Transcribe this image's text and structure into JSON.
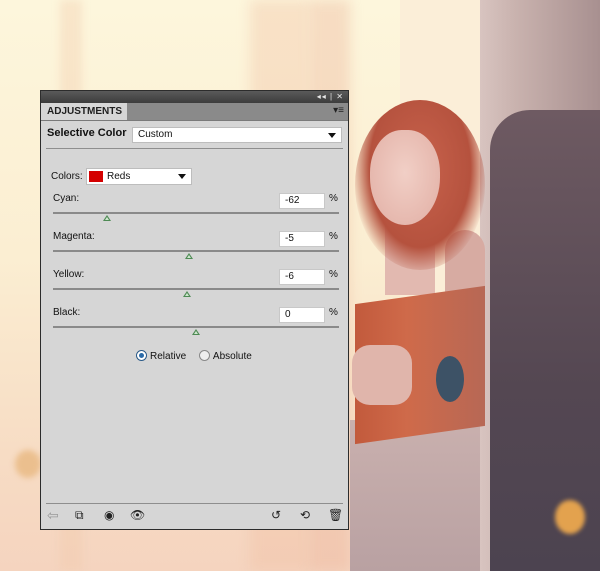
{
  "panel": {
    "title_controls": "◂◂ | ✕",
    "tab_label": "ADJUSTMENTS",
    "menu_icon": "panel-menu-icon",
    "adjustment_name": "Selective Color",
    "preset": "Custom",
    "colors_label": "Colors:",
    "colors_value": "Reds",
    "colors_swatch": "#d40000",
    "sliders": [
      {
        "label": "Cyan:",
        "value": "-62",
        "unit": "%",
        "fraction": 0.19
      },
      {
        "label": "Magenta:",
        "value": "-5",
        "unit": "%",
        "fraction": 0.475
      },
      {
        "label": "Yellow:",
        "value": "-6",
        "unit": "%",
        "fraction": 0.47
      },
      {
        "label": "Black:",
        "value": "0",
        "unit": "%",
        "fraction": 0.5
      }
    ],
    "method": {
      "options": [
        "Relative",
        "Absolute"
      ],
      "selected": "Relative"
    },
    "footer_icons": [
      "back-arrow-icon",
      "clip-to-layer-icon",
      "visibility-mask-icon",
      "eye-icon",
      "previous-state-icon",
      "reset-icon",
      "trash-icon"
    ]
  }
}
